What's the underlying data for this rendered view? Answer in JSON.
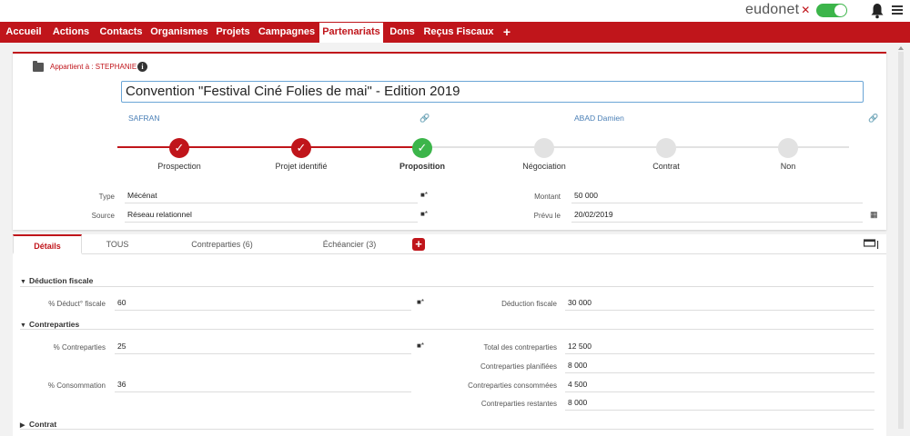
{
  "app": {
    "brand": "eudonet",
    "brand_mark": "✕"
  },
  "nav": {
    "items": [
      "Accueil",
      "Actions",
      "Contacts",
      "Organismes",
      "Projets",
      "Campagnes",
      "Partenariats",
      "Dons",
      "Reçus Fiscaux",
      "+"
    ],
    "active": "Partenariats"
  },
  "header": {
    "owner_label": "Appartient à : STEPHANIE",
    "title": "Convention \"Festival Ciné Folies de mai\" - Edition 2019",
    "left_link": "SAFRAN",
    "right_link": "ABAD Damien"
  },
  "stepper": {
    "steps": [
      {
        "label": "Prospection",
        "state": "done"
      },
      {
        "label": "Projet identifié",
        "state": "done"
      },
      {
        "label": "Proposition",
        "state": "current"
      },
      {
        "label": "Négociation",
        "state": "todo"
      },
      {
        "label": "Contrat",
        "state": "todo"
      },
      {
        "label": "Non",
        "state": "todo"
      }
    ],
    "colors": {
      "done": "#c0151b",
      "current": "#3cb54a",
      "todo": "#e2e2e2"
    }
  },
  "fields": {
    "type_label": "Type",
    "type_value": "Mécénat",
    "source_label": "Source",
    "source_value": "Réseau relationnel",
    "montant_label": "Montant",
    "montant_value": "50 000",
    "prevu_label": "Prévu le",
    "prevu_value": "20/02/2019"
  },
  "tabs": {
    "items": [
      "Détails",
      "TOUS",
      "Contreparties (6)",
      "Échéancier (3)"
    ],
    "active": "Détails",
    "add_label": "+"
  },
  "sections": {
    "deduction": {
      "title": "Déduction fiscale",
      "pct_label": "% Déduct° fiscale",
      "pct_value": "60",
      "amount_label": "Déduction fiscale",
      "amount_value": "30 000"
    },
    "contreparties": {
      "title": "Contreparties",
      "pct_label": "% Contreparties",
      "pct_value": "25",
      "conso_label": "% Consommation",
      "conso_value": "36",
      "total_label": "Total des contreparties",
      "total_value": "12 500",
      "planned_label": "Contreparties planifiées",
      "planned_value": "8 000",
      "consumed_label": "Contreparties consommées",
      "consumed_value": "4 500",
      "remaining_label": "Contreparties restantes",
      "remaining_value": "8 000"
    },
    "contrat": {
      "title": "Contrat"
    }
  },
  "icons": {
    "expanded_arrow": "▼",
    "collapsed_arrow": "▶",
    "link": "🔗",
    "folder_star": "■*",
    "calendar": "▦"
  }
}
